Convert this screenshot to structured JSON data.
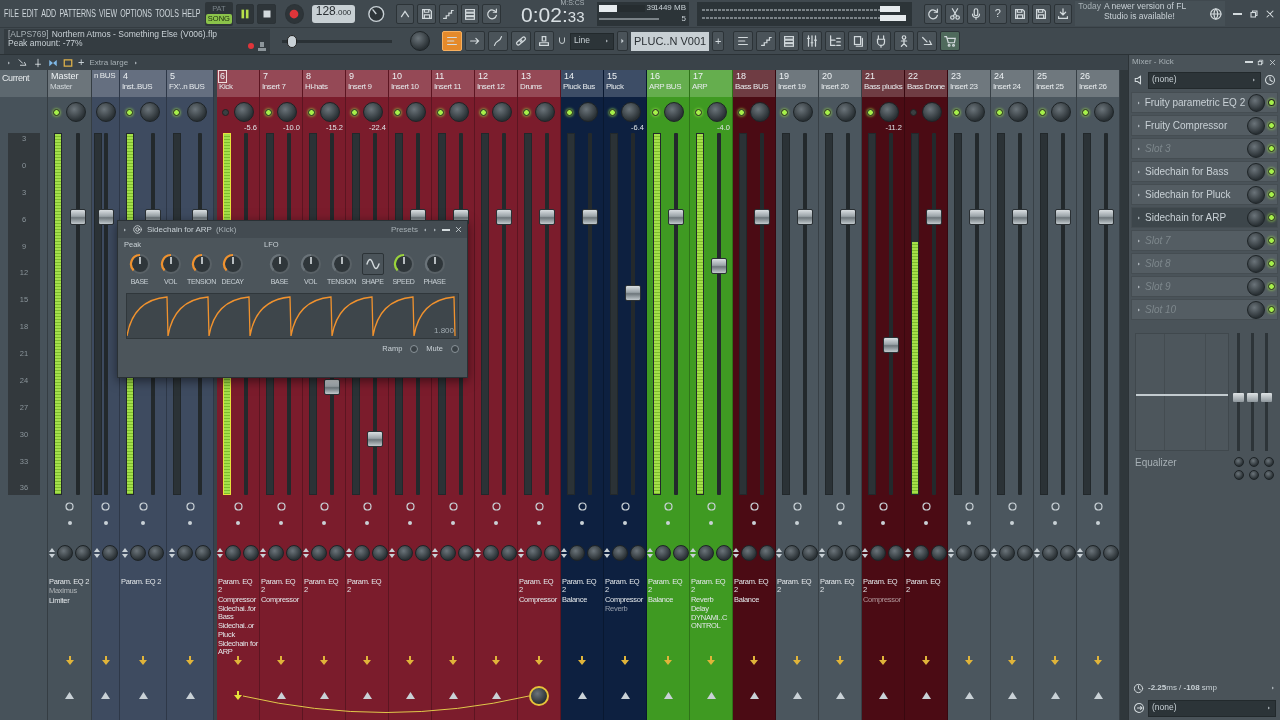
{
  "menu": [
    "FILE",
    "EDIT",
    "ADD",
    "PATTERNS",
    "VIEW",
    "OPTIONS",
    "TOOLS",
    "HELP"
  ],
  "mode": [
    {
      "label": "PAT",
      "selected": false
    },
    {
      "label": "SONG",
      "selected": true
    }
  ],
  "transport": {
    "playing": true
  },
  "tempo": {
    "whole": "128",
    "fraction": ".000"
  },
  "time": {
    "label": "M:S:CS",
    "main": "0:02:",
    "small": "33"
  },
  "cpu": {
    "level": 0.4,
    "value": "39",
    "memory": "1449 MB",
    "polyphony": "5"
  },
  "help_button": "?",
  "news": {
    "when": "Today",
    "text": "A newer version of FL Studio is available!"
  },
  "hint": {
    "file_tag": "[ALPS769]",
    "file_name": "Northern Atmos - Something Else (V006).flp",
    "message": "Peak amount: -77%"
  },
  "main_volume": {
    "level": 0.05
  },
  "tool_buttons": [
    {
      "selected": true
    },
    {
      "selected": false
    },
    {
      "selected": false
    },
    {
      "selected": false
    },
    {
      "selected": false
    }
  ],
  "snap": {
    "value": "Line"
  },
  "pattern": {
    "value": "PLUC..N V001",
    "add": "+"
  },
  "mixer_toolbar": {
    "add": "+",
    "size": "Extra large"
  },
  "strips": [
    {
      "kind": "current",
      "name": "Current",
      "color": "#47525a",
      "scale": [
        "3",
        "0",
        "3",
        "6",
        "9",
        "12",
        "15",
        "18",
        "21",
        "24",
        "27",
        "30",
        "33",
        "36"
      ]
    },
    {
      "kind": "master",
      "number": "Master",
      "name": "Master",
      "color": "#47525a",
      "selected": false,
      "on": true,
      "fader": {
        "level": 0.78
      },
      "meter": {
        "level": 1
      },
      "inserts": [
        {
          "label": "Param. EQ 2",
          "muted": false
        },
        {
          "label": "Maximus",
          "muted": true
        },
        {
          "label": "Limiter",
          "muted": false
        }
      ]
    },
    {
      "kind": "partial",
      "name": "n BUS",
      "color": "#3e4b60",
      "selected": false,
      "fader": {
        "level": 0.78
      },
      "meter": {
        "level": 0
      }
    },
    {
      "kind": "bus",
      "number": "4",
      "name": "Inst..BUS",
      "color": "#3e4b60",
      "selected": false,
      "on": true,
      "fader": {
        "level": 0.78
      },
      "meter": {
        "level": 1
      },
      "inserts": [
        {
          "label": "Param. EQ 2",
          "muted": false
        }
      ]
    },
    {
      "kind": "bus",
      "number": "5",
      "name": "FX'..n BUS",
      "color": "#3e4b60",
      "selected": false,
      "on": true,
      "fader": {
        "level": 0.78
      },
      "meter": {
        "level": 0
      }
    },
    {
      "kind": "insert",
      "number": "6",
      "name": "Kick",
      "color": "#7b1c2c",
      "selected": true,
      "on": false,
      "peak": "-5.6",
      "meter": {
        "level": 1
      },
      "inserts": [
        {
          "label": "Param. EQ 2",
          "muted": false
        },
        {
          "label": "Compressor",
          "muted": false
        },
        {
          "label": "Sidechai..for Bass",
          "muted": false
        },
        {
          "label": "Sidechai..or Pluck",
          "muted": false
        },
        {
          "label": "Sidechain for ARP",
          "muted": false
        }
      ],
      "sending": true
    },
    {
      "kind": "insert",
      "number": "7",
      "name": "Insert 7",
      "color": "#7b1c2c",
      "selected": false,
      "on": true,
      "peak": "-10.0",
      "meter": {
        "level": 0
      },
      "inserts": [
        {
          "label": "Param. EQ 2",
          "muted": false
        },
        {
          "label": "Compressor",
          "muted": false
        }
      ]
    },
    {
      "kind": "insert",
      "number": "8",
      "name": "Hi-hats",
      "color": "#7b1c2c",
      "selected": false,
      "on": true,
      "peak": "-15.2",
      "fader": {
        "level": 0.29
      },
      "meter": {
        "level": 0
      },
      "inserts": [
        {
          "label": "Param. EQ 2",
          "muted": false
        }
      ]
    },
    {
      "kind": "insert",
      "number": "9",
      "name": "Insert 9",
      "color": "#7b1c2c",
      "selected": false,
      "on": true,
      "peak": "-22.4",
      "fader": {
        "level": 0.14
      },
      "meter": {
        "level": 0
      },
      "inserts": [
        {
          "label": "Param. EQ 2",
          "muted": false
        }
      ]
    },
    {
      "kind": "insert",
      "number": "10",
      "name": "Insert 10",
      "color": "#7b1c2c",
      "selected": false,
      "on": true,
      "fader": {
        "level": 0.78
      },
      "meter": {
        "level": 0
      }
    },
    {
      "kind": "insert",
      "number": "11",
      "name": "Insert 11",
      "color": "#7b1c2c",
      "selected": false,
      "on": true,
      "fader": {
        "level": 0.78
      },
      "meter": {
        "level": 0
      }
    },
    {
      "kind": "insert",
      "number": "12",
      "name": "Insert 12",
      "color": "#7b1c2c",
      "selected": false,
      "on": true,
      "fader": {
        "level": 0.78
      },
      "meter": {
        "level": 0
      }
    },
    {
      "kind": "insert",
      "number": "13",
      "name": "Drums",
      "color": "#7b1c2c",
      "selected": false,
      "on": true,
      "fader": {
        "level": 0.78
      },
      "meter": {
        "level": 0
      },
      "inserts": [
        {
          "label": "Param. EQ 2",
          "muted": false
        },
        {
          "label": "Compressor",
          "muted": false
        }
      ],
      "receiving": true
    },
    {
      "kind": "insert",
      "number": "14",
      "name": "Pluck Bus",
      "color": "#0d2040",
      "selected": false,
      "on": true,
      "fader": {
        "level": 0.78
      },
      "meter": {
        "level": 0
      },
      "inserts": [
        {
          "label": "Param. EQ 2",
          "muted": false
        },
        {
          "label": "Balance",
          "muted": false
        }
      ]
    },
    {
      "kind": "insert",
      "number": "15",
      "name": "Pluck",
      "color": "#0d2040",
      "selected": false,
      "on": true,
      "peak": "-6.4",
      "fader": {
        "level": 0.56
      },
      "meter": {
        "level": 0
      },
      "inserts": [
        {
          "label": "Param. EQ 2",
          "muted": false
        },
        {
          "label": "Compressor",
          "muted": false
        },
        {
          "label": "Reverb",
          "muted": true
        }
      ]
    },
    {
      "kind": "insert",
      "number": "16",
      "name": "ARP BUS",
      "color": "#3f9a22",
      "selected": false,
      "on": true,
      "fader": {
        "level": 0.78
      },
      "meter": {
        "level": 1
      },
      "inserts": [
        {
          "label": "Param. EQ 2",
          "muted": false
        },
        {
          "label": "Balance",
          "muted": false
        }
      ]
    },
    {
      "kind": "insert",
      "number": "17",
      "name": "ARP",
      "color": "#3f9a22",
      "selected": false,
      "on": true,
      "peak": "-4.0",
      "fader": {
        "level": 0.64
      },
      "meter": {
        "level": 1
      },
      "inserts": [
        {
          "label": "Param. EQ 2",
          "muted": false
        },
        {
          "label": "Reverb",
          "muted": false
        },
        {
          "label": "Delay",
          "muted": false
        },
        {
          "label": "DYNAMI..CONTROL",
          "muted": false
        }
      ]
    },
    {
      "kind": "insert",
      "number": "18",
      "name": "Bass BUS",
      "color": "#4b0b14",
      "selected": false,
      "on": true,
      "fader": {
        "level": 0.78
      },
      "meter": {
        "level": 0
      },
      "inserts": [
        {
          "label": "Param. EQ 2",
          "muted": false
        },
        {
          "label": "Balance",
          "muted": false
        }
      ]
    },
    {
      "kind": "insert",
      "number": "19",
      "name": "Insert 19",
      "color": "#4b565e",
      "selected": false,
      "on": true,
      "fader": {
        "level": 0.78
      },
      "meter": {
        "level": 0
      },
      "inserts": [
        {
          "label": "Param. EQ 2",
          "muted": false
        }
      ]
    },
    {
      "kind": "insert",
      "number": "20",
      "name": "Insert 20",
      "color": "#4b565e",
      "selected": false,
      "on": true,
      "fader": {
        "level": 0.78
      },
      "meter": {
        "level": 0
      },
      "inserts": [
        {
          "label": "Param. EQ 2",
          "muted": false
        }
      ]
    },
    {
      "kind": "insert",
      "number": "21",
      "name": "Bass plucks",
      "color": "#4b0b14",
      "selected": false,
      "on": true,
      "peak": "-11.2",
      "fader": {
        "level": 0.41
      },
      "meter": {
        "level": 0
      },
      "inserts": [
        {
          "label": "Param. EQ 2",
          "muted": false
        },
        {
          "label": "Compressor",
          "muted": true
        }
      ]
    },
    {
      "kind": "insert",
      "number": "22",
      "name": "Bass Drone",
      "color": "#4b0b14",
      "selected": false,
      "on": false,
      "fader": {
        "level": 0.78
      },
      "meter": {
        "level": 0.7
      },
      "inserts": [
        {
          "label": "Param. EQ 2",
          "muted": false
        }
      ]
    },
    {
      "kind": "insert",
      "number": "23",
      "name": "Insert 23",
      "color": "#4b565e",
      "selected": false,
      "on": true,
      "fader": {
        "level": 0.78
      },
      "meter": {
        "level": 0
      }
    },
    {
      "kind": "insert",
      "number": "24",
      "name": "Insert 24",
      "color": "#4b565e",
      "selected": false,
      "on": true,
      "fader": {
        "level": 0.78
      },
      "meter": {
        "level": 0
      }
    },
    {
      "kind": "insert",
      "number": "25",
      "name": "Insert 25",
      "color": "#4b565e",
      "selected": false,
      "on": true,
      "fader": {
        "level": 0.78
      },
      "meter": {
        "level": 0
      }
    },
    {
      "kind": "insert",
      "number": "26",
      "name": "Insert 26",
      "color": "#4b565e",
      "selected": false,
      "on": true,
      "fader": {
        "level": 0.78
      },
      "meter": {
        "level": 0
      }
    }
  ],
  "plugin_window": {
    "title": "Sidechain for ARP",
    "subtitle": "(Kick)",
    "presets": "Presets",
    "sections": [
      {
        "title": "Peak",
        "knobs": [
          {
            "kind": "knob",
            "label": "BASE",
            "color": "#f0922e"
          },
          {
            "kind": "knob",
            "label": "VOL",
            "color": "#f0922e"
          },
          {
            "kind": "knob",
            "label": "TENSION",
            "color": "#f0922e"
          },
          {
            "kind": "knob",
            "label": "DECAY",
            "color": "#f0922e"
          }
        ]
      },
      {
        "title": "LFO",
        "knobs": [
          {
            "kind": "knob",
            "label": "BASE",
            "color": "#6a7379"
          },
          {
            "kind": "knob",
            "label": "VOL",
            "color": "#6a7379"
          },
          {
            "kind": "knob",
            "label": "TENSION",
            "color": "#6a7379"
          },
          {
            "kind": "shape",
            "label": "SHAPE"
          },
          {
            "kind": "knob",
            "label": "SPEED",
            "color": "#9ad43a"
          },
          {
            "kind": "knob",
            "label": "PHASE",
            "color": "#6a7379"
          }
        ]
      }
    ],
    "envelope_value": "1.800",
    "ramp": "Ramp",
    "mute": "Mute"
  },
  "panel": {
    "title": "Mixer - Kick",
    "input": "(none)",
    "slots": [
      {
        "name": "Fruity parametric EQ 2",
        "empty": false,
        "selected": false,
        "on": true
      },
      {
        "name": "Fruity Compressor",
        "empty": false,
        "selected": false,
        "on": true
      },
      {
        "name": "Slot 3",
        "empty": true,
        "selected": false,
        "on": true
      },
      {
        "name": "Sidechain for Bass",
        "empty": false,
        "selected": false,
        "on": true
      },
      {
        "name": "Sidechain for Pluck",
        "empty": false,
        "selected": false,
        "on": true
      },
      {
        "name": "Sidechain for ARP",
        "empty": false,
        "selected": true,
        "on": true
      },
      {
        "name": "Slot 7",
        "empty": true,
        "selected": false,
        "on": true
      },
      {
        "name": "Slot 8",
        "empty": true,
        "selected": false,
        "on": true
      },
      {
        "name": "Slot 9",
        "empty": true,
        "selected": false,
        "on": true
      },
      {
        "name": "Slot 10",
        "empty": true,
        "selected": false,
        "on": true
      }
    ],
    "eq_bands": [
      {
        "level": 0.45
      },
      {
        "level": 0.45
      },
      {
        "level": 0.45
      }
    ],
    "eq_label": "Equalizer",
    "latency": "**-2.25**ms / **-108** smp",
    "output": "(none)"
  }
}
